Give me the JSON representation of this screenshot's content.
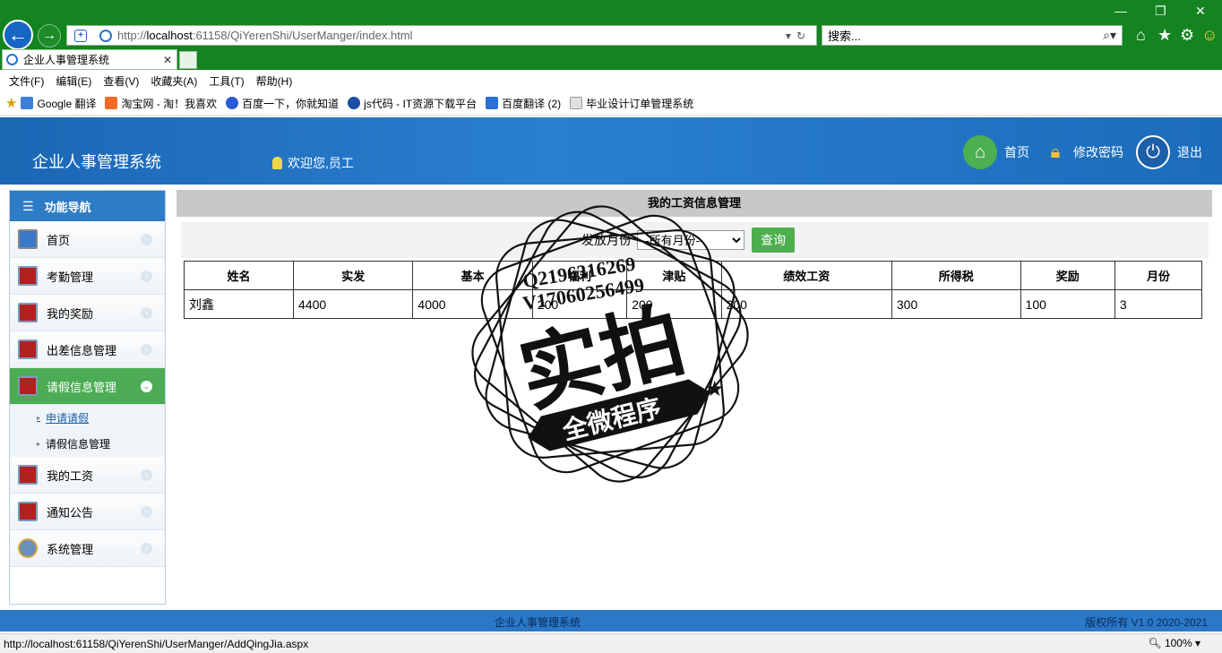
{
  "browser": {
    "url_prefix": "http://",
    "url_host": "localhost",
    "url_rest": ":61158/QiYerenShi/UserManger/index.html",
    "search_placeholder": "搜索...",
    "tab_title": "企业人事管理系统",
    "menu": [
      "文件(F)",
      "编辑(E)",
      "查看(V)",
      "收藏夹(A)",
      "工具(T)",
      "帮助(H)"
    ],
    "favorites": [
      {
        "label": "Google 翻译",
        "icon": "google-translate-icon",
        "color": "#3d7ed8"
      },
      {
        "label": "淘宝网 - 淘！我喜欢",
        "icon": "taobao-icon",
        "color": "#f26b22"
      },
      {
        "label": "百度一下，你就知道",
        "icon": "baidu-icon",
        "color": "#2a5bd7"
      },
      {
        "label": "js代码 - IT资源下载平台",
        "icon": "js-icon",
        "color": "#1e4fa8"
      },
      {
        "label": "百度翻译 (2)",
        "icon": "baidu-translate-icon",
        "color": "#2a6fd6"
      },
      {
        "label": "毕业设计订单管理系统",
        "icon": "page-icon",
        "color": "#e0e0e0"
      }
    ],
    "status_url": "http://localhost:61158/QiYerenShi/UserManger/AddQingJia.aspx",
    "zoom": "100%"
  },
  "app": {
    "title": "企业人事管理系统",
    "welcome": "欢迎您,员工",
    "header_buttons": {
      "home": "首页",
      "change_password": "修改密码",
      "logout": "退出"
    }
  },
  "sidebar": {
    "heading": "功能导航",
    "items": [
      {
        "label": "首页",
        "icon": "monitor-icon"
      },
      {
        "label": "考勤管理",
        "icon": "pdf-icon"
      },
      {
        "label": "我的奖励",
        "icon": "pdf-icon"
      },
      {
        "label": "出差信息管理",
        "icon": "pdf-icon"
      },
      {
        "label": "请假信息管理",
        "icon": "pdf-icon"
      },
      {
        "label": "我的工资",
        "icon": "pdf-icon"
      },
      {
        "label": "通知公告",
        "icon": "pdf-icon"
      },
      {
        "label": "系统管理",
        "icon": "gear-icon"
      }
    ],
    "subitems": [
      "申请请假",
      "请假信息管理"
    ]
  },
  "content": {
    "title": "我的工资信息管理",
    "filter_label": "发放月份",
    "month_selected": "--所有月份--",
    "query_button": "查询",
    "columns": [
      "姓名",
      "实发",
      "基本",
      "福利",
      "津贴",
      "绩效工资",
      "所得税",
      "奖励",
      "月份"
    ],
    "rows": [
      [
        "刘鑫",
        "4400",
        "4000",
        "200",
        "200",
        "200",
        "300",
        "100",
        "3"
      ]
    ]
  },
  "watermark": {
    "line1": "Q2196316269",
    "line2": "V17060256499",
    "main": "实拍",
    "banner": "全微程序"
  },
  "footer": {
    "center": "企业人事管理系统",
    "right": "版权所有 V1.0 2020-2021"
  },
  "colors": {
    "browser_green": "#13841f",
    "header_blue": "#2a7fd0",
    "active_nav": "#4cac55",
    "query_button": "#4cae4c"
  }
}
